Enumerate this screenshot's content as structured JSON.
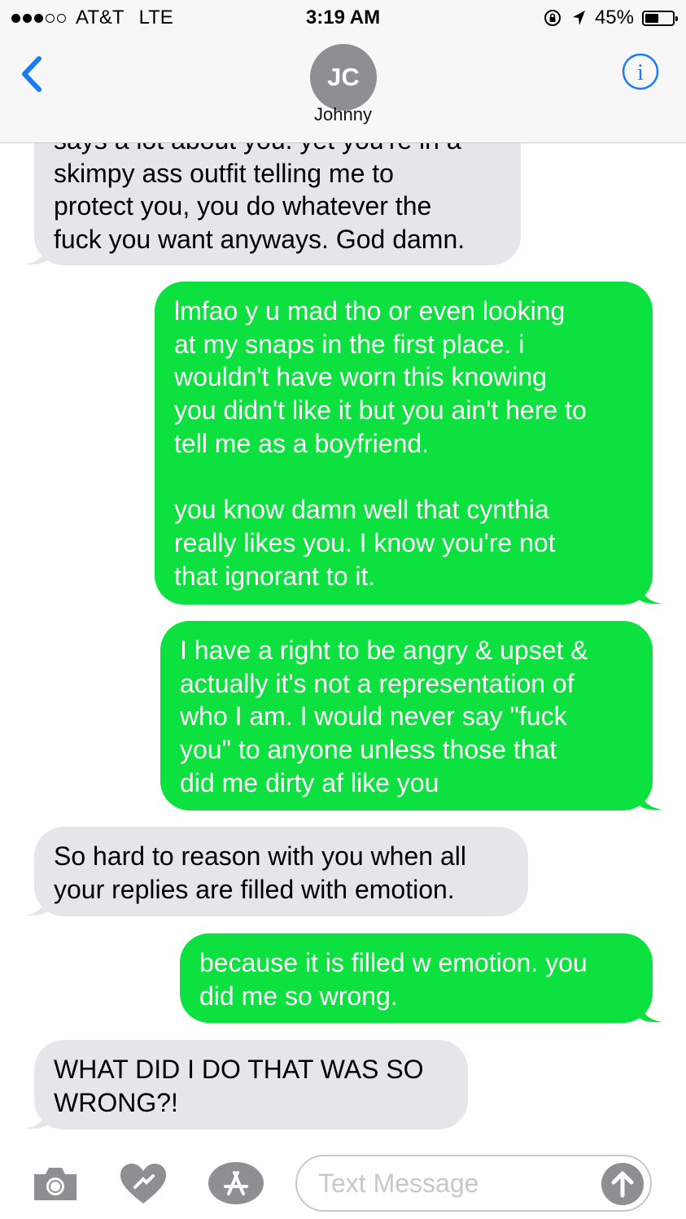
{
  "status_bar": {
    "carrier": "AT&T",
    "network": "LTE",
    "time": "3:19 AM",
    "battery": "45%",
    "battery_level": 0.45,
    "icons": [
      "signal-dots",
      "rotation-lock-icon",
      "location-arrow-icon",
      "battery-icon"
    ]
  },
  "header": {
    "back_icon": "chevron-left-icon",
    "avatar_initials": "JC",
    "contact_name": "Johnny",
    "info_icon": "info-icon"
  },
  "messages": [
    {
      "direction": "incoming",
      "text": "says a lot about you. yet you're in a\nskimpy ass outfit telling me to\nprotect you, you do whatever the\nfuck you want anyways. God damn."
    },
    {
      "direction": "outgoing",
      "text": "lmfao y u mad tho or even looking\nat my snaps in the first place. i\nwouldn't have worn this knowing\nyou didn't like it but you ain't here to\ntell me as a boyfriend.\n\nyou know damn well that cynthia\nreally likes you. I know you're not\nthat ignorant to it."
    },
    {
      "direction": "outgoing",
      "text": "I have a right to be angry & upset &\nactually it's not a representation of\nwho I am. I would never say \"fuck\nyou\" to anyone unless those that\ndid me dirty af like you"
    },
    {
      "direction": "incoming",
      "text": "So hard to reason with you when all\nyour replies are filled with emotion."
    },
    {
      "direction": "outgoing",
      "text": "because it is filled w emotion. you\ndid me so wrong."
    },
    {
      "direction": "incoming",
      "text": "WHAT DID I DO THAT WAS SO\nWRONG?!"
    }
  ],
  "input_bar": {
    "placeholder": "Text Message",
    "icons": [
      "camera-icon",
      "digital-touch-icon",
      "app-store-icon",
      "send-arrow-icon"
    ]
  },
  "colors": {
    "outgoing_bubble": "#0ce13f",
    "incoming_bubble": "#e5e5ea",
    "accent": "#1a7cf5",
    "avatar_bg": "#8e8e93"
  }
}
